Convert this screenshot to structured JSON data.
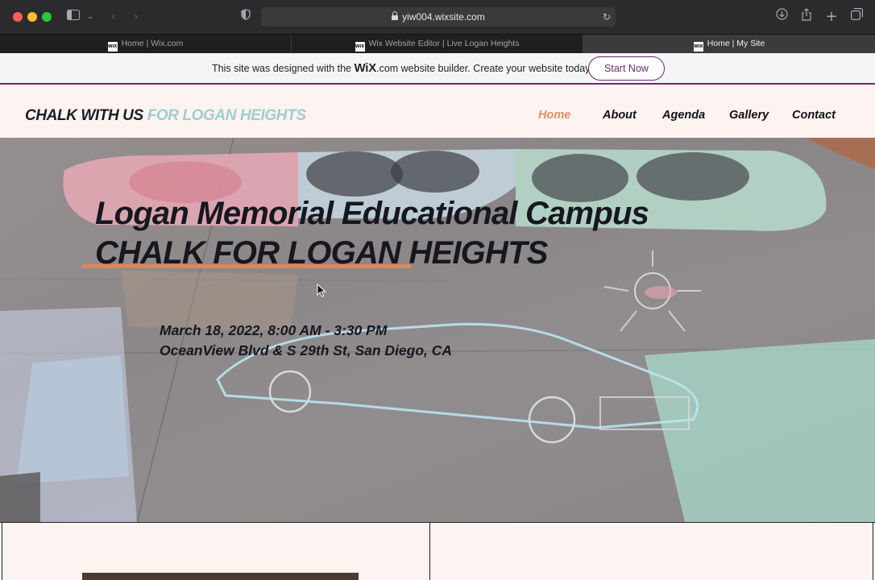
{
  "browser": {
    "url": "yiw004.wixsite.com",
    "tabs": [
      {
        "title": "Home | Wix.com",
        "favicon": "WIX",
        "active": false
      },
      {
        "title": "Wix Website Editor | Live Logan Heights",
        "favicon": "WIX",
        "active": false
      },
      {
        "title": "Home | My Site",
        "favicon": "WIX",
        "active": true
      }
    ],
    "icons": [
      "sidebar-icon",
      "chevron-down-icon",
      "back-icon",
      "forward-icon",
      "shield-icon",
      "reload-icon",
      "download-icon",
      "share-icon",
      "new-tab-icon",
      "tab-overview-icon"
    ]
  },
  "banner": {
    "text_before": "This site was designed with the ",
    "brand": "WiX",
    "text_after": ".com website builder. Create your website today.",
    "button_label": "Start Now",
    "accent": "#6a2a6b"
  },
  "site": {
    "logo_part1": "CHALK WITH US",
    "logo_part2": "FOR LOGAN HEIGHTS",
    "nav": [
      "Home",
      "About",
      "Agenda",
      "Gallery",
      "Contact"
    ],
    "active_nav": "Home",
    "colors": {
      "nav_active": "#e0906b",
      "logo_accent": "#9fcecb",
      "header_bg": "#fdf3f1",
      "underline": "#e2825e"
    }
  },
  "hero": {
    "title_line1": "Logan Memorial Educational Campus",
    "title_line2": "CHALK FOR LOGAN HEIGHTS",
    "date": "March 18, 2022, 8:00 AM - 3:30 PM",
    "location": "OceanView Blvd & S 29th St, San Diego, CA"
  }
}
